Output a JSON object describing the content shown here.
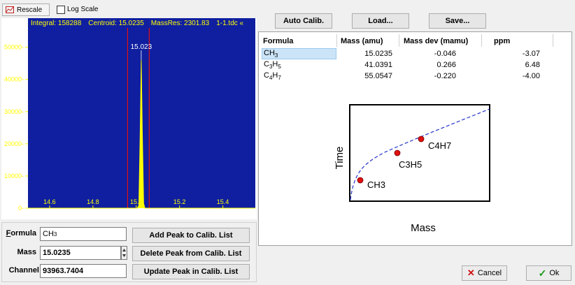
{
  "toolbar": {
    "rescale_label": "Rescale",
    "log_scale_label": "Log Scale"
  },
  "spectrum": {
    "info": {
      "integral": "Integral: 158288",
      "centroid": "Centroid: 15.0235",
      "massres": "MassRes: 2301.83",
      "file": "1-1.tdc «"
    },
    "peak_label": "15.023",
    "colors": {
      "background": "#0f1fa0",
      "peak": "#ffff00",
      "marker": "#e01010",
      "axis_text": "#ffff00"
    }
  },
  "chart_data": {
    "type": "line",
    "x_ticks": [
      "14.6",
      "14.8",
      "15.0",
      "15.2",
      "15.4"
    ],
    "y_ticks": [
      "0",
      "10000",
      "20000",
      "30000",
      "40000",
      "50000"
    ],
    "xlim": [
      14.5,
      15.55
    ],
    "ylim": [
      0,
      56000
    ],
    "markers": [
      14.96,
      15.06
    ],
    "series": [
      {
        "x": [
          14.5,
          15.005,
          15.012,
          15.018,
          15.023,
          15.028,
          15.034,
          15.04,
          15.55
        ],
        "y": [
          0,
          0,
          800,
          22000,
          46000,
          24000,
          1500,
          0,
          0
        ]
      }
    ]
  },
  "peak_form": {
    "formula_label": "Formula",
    "formula_value": "CH3",
    "mass_label": "Mass",
    "mass_value": "15.0235",
    "channel_label": "Channel",
    "channel_value": "93963.7404",
    "add_label": "Add Peak to Calib. List",
    "delete_label": "Delete Peak from Calib. List",
    "update_label": "Update Peak in Calib. List"
  },
  "calib_buttons": {
    "auto_label": "Auto Calib.",
    "load_label": "Load...",
    "save_label": "Save..."
  },
  "calib_table": {
    "headers": [
      "Formula",
      "Mass (amu)",
      "Mass dev (mamu)",
      "ppm"
    ],
    "rows": [
      {
        "formula": "CH3",
        "mass": "15.0235",
        "dev": "-0.046",
        "ppm": "-3.07"
      },
      {
        "formula": "C3H5",
        "mass": "41.0391",
        "dev": "0.266",
        "ppm": "6.48"
      },
      {
        "formula": "C4H7",
        "mass": "55.0547",
        "dev": "-0.220",
        "ppm": "-4.00"
      }
    ]
  },
  "calib_plot": {
    "xlabel": "Mass",
    "ylabel": "Time",
    "points": [
      {
        "label": "CH3"
      },
      {
        "label": "C3H5"
      },
      {
        "label": "C4H7"
      }
    ]
  },
  "dialog": {
    "cancel_label": "Cancel",
    "ok_label": "Ok"
  }
}
